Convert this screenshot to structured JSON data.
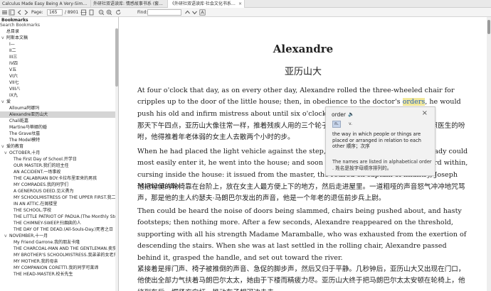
{
  "tabs": [
    {
      "label": "Calculus Made Easy Being A Very-Simp...",
      "active": false
    },
    {
      "label": "外研社双语读库: 情感故事书系 (套...",
      "active": false
    },
    {
      "label": "《外研社双语读库·社会文化书系》 (...",
      "active": true
    }
  ],
  "toolbar": {
    "page_label": "Page:",
    "page_value": "165",
    "page_total": "/ 8901",
    "find_label": "Find:"
  },
  "sidebar": {
    "title": "Bookmarks",
    "search_label": "Search Bookmarks",
    "items": [
      {
        "label": "总目录",
        "toggle": "",
        "indent": 0
      },
      {
        "label": "阿斯本文稿",
        "toggle": "v",
        "indent": 0
      },
      {
        "label": "I—",
        "toggle": "",
        "indent": 1
      },
      {
        "label": "II二",
        "toggle": "",
        "indent": 1
      },
      {
        "label": "III三",
        "toggle": "",
        "indent": 1
      },
      {
        "label": "IV四",
        "toggle": "",
        "indent": 1
      },
      {
        "label": "V五",
        "toggle": "",
        "indent": 1
      },
      {
        "label": "VI六",
        "toggle": "",
        "indent": 1
      },
      {
        "label": "VII七",
        "toggle": "",
        "indent": 1
      },
      {
        "label": "VIII八",
        "toggle": "",
        "indent": 1
      },
      {
        "label": "IX九",
        "toggle": "",
        "indent": 1
      },
      {
        "label": "爱",
        "toggle": "v",
        "indent": 0
      },
      {
        "label": "Allouma阿娜玛",
        "toggle": "",
        "indent": 1
      },
      {
        "label": "Alexandre亚历山大",
        "toggle": "",
        "indent": 1,
        "selected": true
      },
      {
        "label": "Chali乾嘉",
        "toggle": "",
        "indent": 1
      },
      {
        "label": "Martine马蒂娜的婚",
        "toggle": "",
        "indent": 1
      },
      {
        "label": "The Grave坟墓",
        "toggle": "",
        "indent": 1
      },
      {
        "label": "The Model模特",
        "toggle": "",
        "indent": 1
      },
      {
        "label": "爱的教育",
        "toggle": "v",
        "indent": 0
      },
      {
        "label": "OCTOBER,十月",
        "toggle": "v",
        "indent": 1
      },
      {
        "label": "The First Day of School.开学日",
        "toggle": "",
        "indent": 2
      },
      {
        "label": "OUR MASTER.我们的班主任",
        "toggle": "",
        "indent": 2
      },
      {
        "label": "AN ACCIDENT.一场事故",
        "toggle": "",
        "indent": 2
      },
      {
        "label": "THE CALABRIAN BOY.卡拉布里亚来的男孩",
        "toggle": "",
        "indent": 2
      },
      {
        "label": "MY COMRADES.我的同学们",
        "toggle": "",
        "indent": 2
      },
      {
        "label": "A GENEROUS DEED.见义勇为",
        "toggle": "",
        "indent": 2
      },
      {
        "label": "MY SCHOOLMISTRESS OF THE UPPER FIRST.我二年级的老师",
        "toggle": "",
        "indent": 2
      },
      {
        "label": "IN AN ATTIC.在阁楼里",
        "toggle": "",
        "indent": 2
      },
      {
        "label": "THE SCHOOL.学校",
        "toggle": "",
        "indent": 2
      },
      {
        "label": "THE LITTLE PATRIOT OF PADUA.(The Monthly Story.)",
        "toggle": "",
        "indent": 2
      },
      {
        "label": "THE CHIMNEY-SWEEP.扫烟囱的人",
        "toggle": "",
        "indent": 2
      },
      {
        "label": "THE DAY OF THE DEAD.(All-Souls-Day.)死者之日（万",
        "toggle": "",
        "indent": 2
      },
      {
        "label": "NOVEMBER,十一月",
        "toggle": "v",
        "indent": 1
      },
      {
        "label": "My Friend Garrone.我的朋友卡隆",
        "toggle": "",
        "indent": 2
      },
      {
        "label": "THE CHARCOAL-MAN AND THE GENTLEMAN.卖炭人",
        "toggle": "",
        "indent": 2
      },
      {
        "label": "MY BROTHER'S SCHOOLMISTRESS.我弟弟的女老师",
        "toggle": "",
        "indent": 2
      },
      {
        "label": "MY MOTHER.我的母亲",
        "toggle": "",
        "indent": 2
      },
      {
        "label": "MY COMPANION CORETTI.我的同学可莱谛",
        "toggle": "",
        "indent": 2
      },
      {
        "label": "THE HEAD-MASTER.校长先生",
        "toggle": "",
        "indent": 2
      }
    ]
  },
  "document": {
    "title": "Alexandre",
    "subtitle": "亚历山大",
    "p1_before": "At four o'clock that day, as on every other day, Alexandre rolled the three-wheeled chair for cripples up to the door of the little house; then, in obedience to the doctor's ",
    "p1_highlight": "orders",
    "p1_after": ", he would push his old and infirm mistress about until six o'clock.",
    "p2": "那天下午四点，亚历山大像往常一样，推着残疾人用的三个轮子的椅子来到了小房子门口，然后遵照医生的吩咐，他得推着年老体弱的女主人去散两个小时的步。",
    "p3": "When he had placed the light vehicle against the step, just at the spot where the old lady could most easily enter it, he went into the house; and soon a furious, hoarse voice was heard within, cursing inside the house: it issued from the master, the retired ex-captain of infantry, Joseph Maramballe.",
    "p4": "他把轻便的轮椅靠在台阶上，放在女主人最方便上下的地方，然后走进屋里。一道粗哑的声音怒气冲冲地咒骂声，那是他的主人约瑟夫·马朗巴尔发出的声音，他是一个年老的退伍前步兵上尉。",
    "p5": "Then could be heard the noise of doors being slammed, chairs being pushed about, and hasty footsteps; then nothing more. After a few seconds, Alexandre reappeared on the threshold, supporting with all his strength Madame Maramballe, who was exhausted from the exertion of descending the stairs. When she was at last settled in the rolling chair, Alexandre passed behind it, grasped the handle, and set out toward the river.",
    "p6": "紧接着是摔门声、椅子被推倒的声音、急促的脚步声，然后又归于平静。几秒钟后，亚历山大又出现在门口，他使出全部力气扶着马朗巴尔太太，她由于下楼而精疲力尽。亚历山大终于把马朗巴尔太太安顿在轮椅上，他绕到车后，握紧方向杆，推动车子朝河边走去。"
  },
  "dictionary": {
    "word": "order",
    "pos_tab": "n.",
    "pos_tab2": "v.",
    "definition": "the way in which people or things are placed or arranged in relation to each other 顺序；次序",
    "example": "The names are listed in alphabetical order . 姓名是按字母顺序排列的。"
  }
}
